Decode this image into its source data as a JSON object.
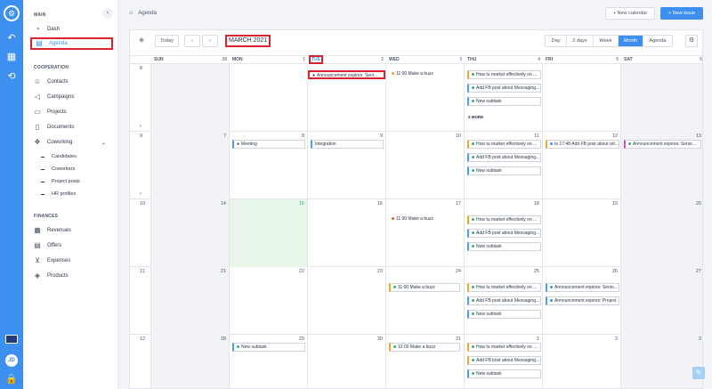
{
  "rail": {
    "logo_icon": "organization-logo-icon",
    "items": [
      "back-arrow-icon",
      "grid-icon",
      "refresh-icon"
    ],
    "flag_icon": "uk-flag-icon",
    "avatar": "JD",
    "bottom_icon": "lock-icon"
  },
  "sidebar": {
    "main_title": "MAIN",
    "main_items": [
      {
        "label": "Dash",
        "icon": "speedometer-icon"
      },
      {
        "label": "Agenda",
        "icon": "calendar-icon",
        "active": true
      }
    ],
    "coop_title": "COOPERATION",
    "coop_items": [
      {
        "label": "Contacts",
        "icon": "contacts-icon"
      },
      {
        "label": "Campaigns",
        "icon": "megaphone-icon"
      },
      {
        "label": "Projects",
        "icon": "folder-icon"
      },
      {
        "label": "Documents",
        "icon": "document-icon"
      },
      {
        "label": "Coworking",
        "icon": "coworking-icon"
      }
    ],
    "coworking_sub": [
      "Candidates",
      "Coworkers",
      "Project posts",
      "HR profiles"
    ],
    "fin_title": "FINANCES",
    "fin_items": [
      {
        "label": "Revenues",
        "icon": "revenue-icon"
      },
      {
        "label": "Offers",
        "icon": "offers-icon"
      },
      {
        "label": "Expenses",
        "icon": "cart-icon"
      },
      {
        "label": "Products",
        "icon": "box-icon"
      }
    ]
  },
  "topbar": {
    "breadcrumb": "Agenda",
    "new_calendar": "+ New calendar",
    "new_issue": "+ New issue"
  },
  "toolbar": {
    "today": "Today",
    "prev": "‹",
    "next": "›",
    "month_title": "MARCH 2021",
    "views": [
      "Day",
      "2 days",
      "Week",
      "Month",
      "Agenda"
    ],
    "active_view": "Month"
  },
  "headers": [
    {
      "label": "SUN",
      "num": "28"
    },
    {
      "label": "MON",
      "num": "1"
    },
    {
      "label": "TUE",
      "num": "2"
    },
    {
      "label": "WED",
      "num": "3"
    },
    {
      "label": "THU",
      "num": "4"
    },
    {
      "label": "FRI",
      "num": "5"
    },
    {
      "label": "SAT",
      "num": "6"
    }
  ],
  "week_numbers": [
    "8",
    "9",
    "10",
    "11",
    "12"
  ],
  "weeks": [
    [
      "",
      "",
      "",
      "",
      "",
      "",
      ""
    ],
    [
      "7",
      "8",
      "9",
      "10",
      "11",
      "12",
      "13"
    ],
    [
      "14",
      "15",
      "16",
      "17",
      "18",
      "19",
      "20"
    ],
    [
      "21",
      "22",
      "23",
      "24",
      "25",
      "26",
      "27"
    ],
    [
      "28",
      "29",
      "30",
      "31",
      "1",
      "2",
      "3"
    ]
  ],
  "events": {
    "e1": "Announcement expires: Seni...",
    "e2": "11:00 Make a buzz",
    "e3": "How tu market effectively on ...",
    "e4": "Add FB post about Messaging...",
    "e5": "New subtask",
    "more": "3 MORE",
    "e6": "Meeting",
    "e7": "Integration",
    "e8": "How tu market effectively on ...",
    "e9": "Add FB post about Messaging...",
    "e10": "New subtask",
    "e11": "to 17:48 Add FB post about ret...",
    "e12": "Announcement expires: Senio...",
    "e13": "11:00 Make a buzz",
    "e14": "How tu market effectively on ...",
    "e15": "Add FB post about Messaging...",
    "e16": "New subtask",
    "e17": "11:00 Make a buzz",
    "e18": "How tu market effectively on ...",
    "e19": "Add FB post about Messaging...",
    "e20": "New subtask",
    "e21": "Announcement expires: Senio...",
    "e22": "Announcement expires: Project",
    "e23": "New subtask",
    "e24": "12:00 Make a buzz",
    "e25": "How tu market effectively on ...",
    "e26": "Add FB post about Messaging...",
    "e27": "New subtask"
  },
  "colors": {
    "accent": "#3d8ff0",
    "highlight": "#d9232e",
    "orange": "#f5a524",
    "green_dot": "#2bb673",
    "pink": "#e34bb3",
    "today_bg": "#e8f6e9"
  }
}
